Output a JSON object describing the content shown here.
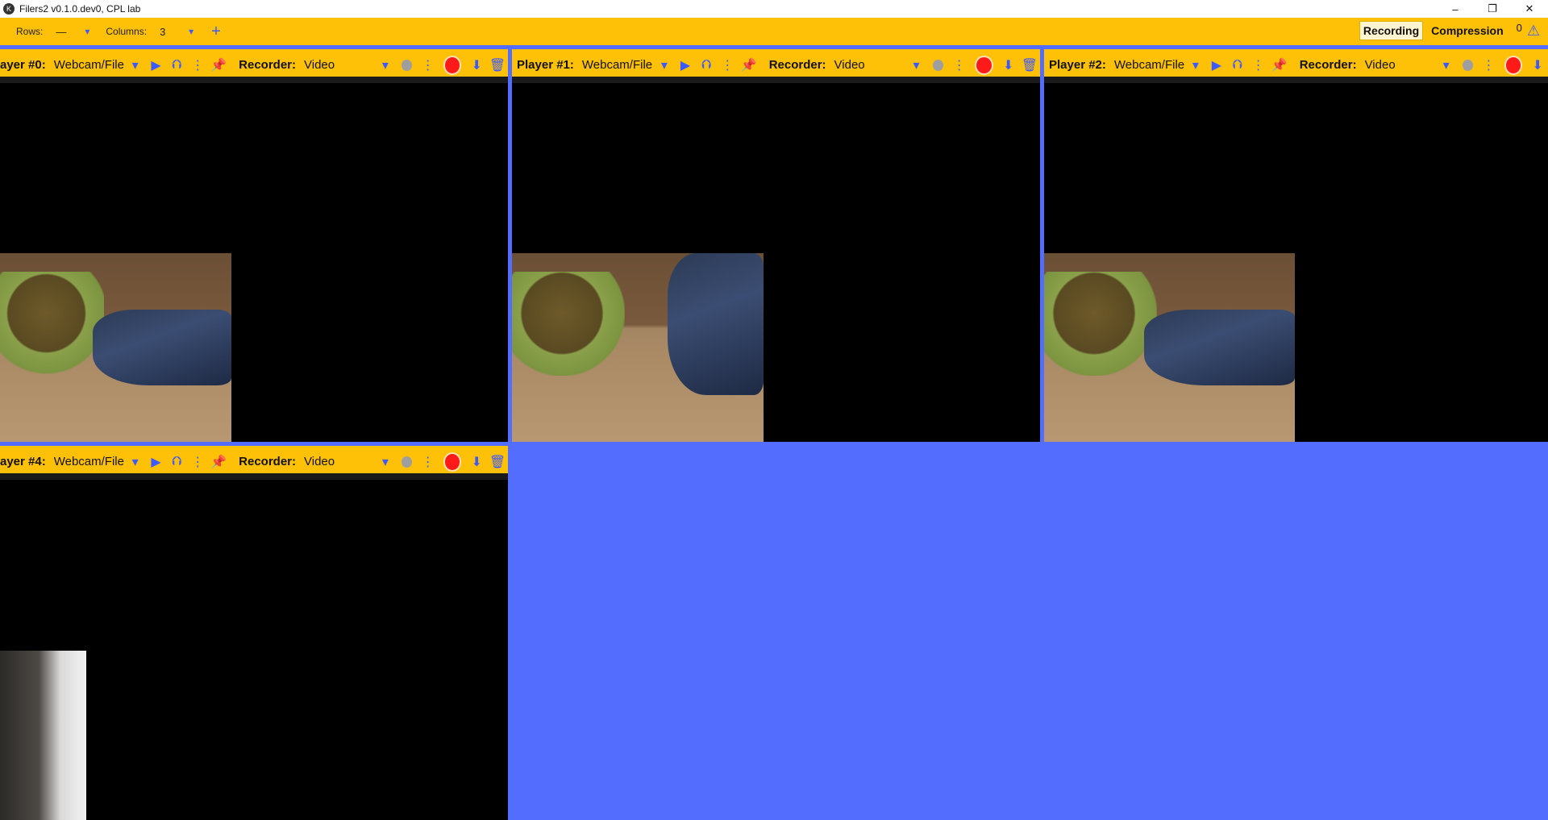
{
  "window": {
    "title": "Filers2 v0.1.0.dev0, CPL lab",
    "minimize": "–",
    "maximize": "❐",
    "close": "✕"
  },
  "toolbar": {
    "rows_label": "Rows:",
    "rows_value": "—",
    "columns_label": "Columns:",
    "columns_value": "3",
    "recording_tab": "Recording",
    "compression_tab": "Compression",
    "error_count": "0"
  },
  "players": [
    {
      "label": "ayer #0:",
      "source": "Webcam/File",
      "recorder_label": "Recorder:",
      "recorder_value": "Video"
    },
    {
      "label": "Player #1:",
      "source": "Webcam/File",
      "recorder_label": "Recorder:",
      "recorder_value": "Video"
    },
    {
      "label": "Player #2:",
      "source": "Webcam/File",
      "recorder_label": "Recorder:",
      "recorder_value": "Video"
    },
    {
      "label": "ayer #4:",
      "source": "Webcam/File",
      "recorder_label": "Recorder:",
      "recorder_value": "Video"
    }
  ],
  "icons": {
    "caret": "▾",
    "play": "▶",
    "settings": "⮉",
    "more": "⋮",
    "pin": "📌",
    "save": "⬇",
    "delete": "🗑",
    "plus": "+",
    "warning": "⚠"
  },
  "colors": {
    "toolbar": "#ffc107",
    "accent": "#3d5afe",
    "background": "#536dfe",
    "record": "#ff1a1a"
  }
}
